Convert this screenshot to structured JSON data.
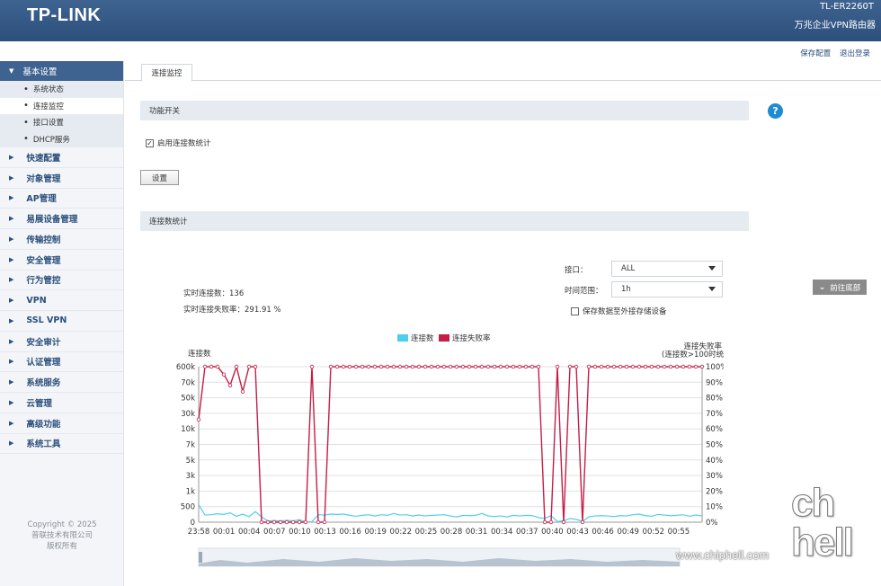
{
  "header": {
    "logo": "TP-LINK",
    "model": "TL-ER2260T",
    "subtitle": "万兆企业VPN路由器"
  },
  "toplinks": {
    "save": "保存配置",
    "logout": "退出登录"
  },
  "sidebar": {
    "expanded": {
      "label": "基本设置",
      "children": [
        "系统状态",
        "连接监控",
        "接口设置",
        "DHCP服务"
      ]
    },
    "items": [
      "快速配置",
      "对象管理",
      "AP管理",
      "易展设备管理",
      "传输控制",
      "安全管理",
      "行为管控",
      "VPN",
      "SSL VPN",
      "安全审计",
      "认证管理",
      "系统服务",
      "云管理",
      "高级功能",
      "系统工具"
    ],
    "copyright": [
      "Copyright © 2025",
      "普联技术有限公司",
      "版权所有"
    ]
  },
  "tab": "连接监控",
  "feature": {
    "section": "功能开关",
    "checkbox_label": "启用连接数统计",
    "checked": true,
    "button": "设置"
  },
  "stats": {
    "section": "连接数统计",
    "realtime_label": "实时连接数：",
    "realtime_value": "136",
    "fail_label": "实时连接失败率：",
    "fail_value": "291.91 %",
    "interface_label": "接口：",
    "interface_value": "ALL",
    "range_label": "时间范围：",
    "range_value": "1h",
    "save_ext": "保存数据至外接存储设备"
  },
  "goto_bottom": "前往底部",
  "watermark": {
    "url": "www.chiphell.com",
    "logo": "chip hell"
  },
  "colors": {
    "header": "#3f6390",
    "conn": "#4fcdf0",
    "fail": "#c41e47"
  },
  "chart_data": {
    "type": "line",
    "legend": [
      "连接数",
      "连接失败率"
    ],
    "ylabel_left": "连接数",
    "ylabel_right": [
      "连接失败率",
      "(连接数>100时统计)"
    ],
    "left_ticks": [
      "0",
      "500",
      "1k",
      "3k",
      "5k",
      "7k",
      "10k",
      "30k",
      "50k",
      "70k",
      "600k"
    ],
    "right_ticks": [
      "0%",
      "10%",
      "20%",
      "30%",
      "40%",
      "50%",
      "60%",
      "70%",
      "80%",
      "90%",
      "100%"
    ],
    "x_ticks": [
      "23:58",
      "00:01",
      "00:04",
      "00:07",
      "00:10",
      "00:13",
      "00:16",
      "00:19",
      "00:22",
      "00:25",
      "00:28",
      "00:31",
      "00:34",
      "00:37",
      "00:40",
      "00:43",
      "00:46",
      "00:49",
      "00:52",
      "00:55"
    ],
    "series": [
      {
        "name": "连接数",
        "values": [
          560,
          230,
          240,
          270,
          250,
          300,
          190,
          260,
          180,
          340,
          170,
          40,
          50,
          40,
          60,
          40,
          80,
          10,
          10,
          240,
          230,
          260,
          250,
          260,
          220,
          190,
          220,
          240,
          200,
          240,
          220,
          280,
          230,
          240,
          200,
          230,
          200,
          220,
          230,
          240,
          200,
          170,
          220,
          210,
          220,
          280,
          200,
          180,
          200,
          170,
          220,
          200,
          220,
          210,
          150,
          120,
          210,
          20,
          50,
          120,
          90,
          30,
          170,
          200,
          210,
          200,
          180,
          210,
          200,
          240,
          260,
          210,
          190,
          250,
          230,
          210,
          220,
          240,
          190,
          230,
          200
        ]
      },
      {
        "name": "连接失败率",
        "values": [
          66,
          100,
          100,
          100,
          95,
          88,
          100,
          84,
          100,
          100,
          0,
          0,
          0,
          0,
          0,
          0,
          0,
          0,
          100,
          0,
          0,
          100,
          100,
          100,
          100,
          100,
          100,
          100,
          100,
          100,
          100,
          100,
          100,
          100,
          100,
          100,
          100,
          100,
          100,
          100,
          100,
          100,
          100,
          100,
          100,
          100,
          100,
          100,
          100,
          100,
          100,
          100,
          100,
          100,
          100,
          0,
          0,
          100,
          0,
          100,
          100,
          0,
          100,
          100,
          100,
          100,
          100,
          100,
          100,
          100,
          100,
          100,
          100,
          100,
          100,
          100,
          100,
          100,
          100,
          100,
          100
        ]
      }
    ]
  }
}
